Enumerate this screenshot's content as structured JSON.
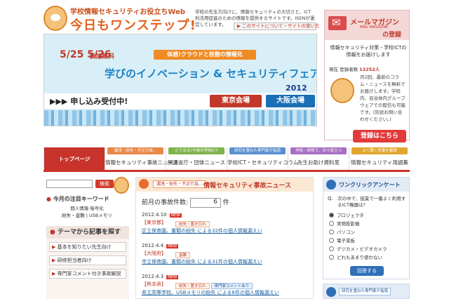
{
  "header": {
    "tagline": "学校情報セキュリティお役立ちWeb",
    "logo_main": "今日もワンステップ!",
    "description": "学校の先生方向けに、情報セキュリティの大切さと、ICT利活用促進のための情報を提供するサイトです。ISENが運営しています。",
    "about_link": "▶ このサイトについて・サイトの使い方"
  },
  "banner": {
    "dates": "5/25 5/26",
    "free": "参加無料",
    "ribbon": "体感!クラウドと校務の情報化",
    "fair_title": "学びのイノベーション & セキュリティフェア",
    "year": "2012",
    "apply": "▶▶▶ 申し込み受付中!",
    "venue_tokyo": "東京会場",
    "venue_osaka": "大阪会場"
  },
  "mail": {
    "title": "メールマガジン",
    "subtitle": "MAIL MAGAZINE",
    "title2": "の登録",
    "intro": "情報セキュリティ対策・学校ICTの情報をお届けします",
    "registered_label": "現在 登録者数",
    "registered_count": "13252人",
    "body": "月2回、最新のコラム・ニュースを無料でお届けします。学校内、自治体内グループウェアでの配信も可能です。(別途お問い合わせください。)",
    "register_button": "登録はこちら"
  },
  "nav": {
    "items": [
      {
        "pill": "",
        "label": "トップページ"
      },
      {
        "pill": "漏洩・紛失・不正行為…",
        "label": "情報セキュリティ事故ニュース"
      },
      {
        "pill": "どうなる?今後の学校ICT",
        "label": "関連省庁・団体ニュース"
      },
      {
        "pill": "研究を重ねた専門家が指南",
        "label": "学校ICT・セキュリティコラム"
      },
      {
        "pill": "学校・研修で、日々役立つ",
        "label": "先生お助け資料室"
      },
      {
        "pill": "よく聞く言葉を解説",
        "label": "情報セキュリティ用語集"
      }
    ]
  },
  "left": {
    "search_button": "検索",
    "keyword_title": "今月の注目キーワード",
    "keyword_links": "個人情報   暗号化 \n 紛失・盗難 | USBメモリ",
    "theme_title": "テーマから記事を探す",
    "theme_items": [
      "基本を知りたい先生向け",
      "研修担当者向け",
      "専門家コメント付き事故解説"
    ]
  },
  "center": {
    "pill": "漏洩・紛失・不正行為…",
    "title": "情報セキュリティ事故ニュース",
    "count_label": "前月の事故件数:",
    "count_value": "6",
    "count_unit": "件",
    "news": [
      {
        "date": "2012.4.10",
        "new": "NEW",
        "pref": "【東京都】",
        "tags": [
          "紛失・置き忘れ"
        ],
        "title": "区立保育園、書類の紛失 による32件の個人情報漏えい"
      },
      {
        "date": "2012.4.4",
        "new": "NEW",
        "pref": "【大阪府】",
        "tags": [
          "盗難"
        ],
        "title": "市立保育園、書類の紛失 による31件の個人情報漏えい"
      },
      {
        "date": "2012.4.3",
        "new": "NEW",
        "pref": "【熊本県】",
        "tags": [
          "紛失・置き忘れ",
          "専門家コメントあり"
        ],
        "title": "県立高等学校、USBメモリの紛失 による6件の個人情報漏えい"
      }
    ]
  },
  "right": {
    "poll_title": "ワンクリックアンケート",
    "poll_qn": "Q.",
    "poll_question": "次の中で、授業で一番よく利用するICT機器は?",
    "options": [
      "プロジェクタ",
      "実物投影機",
      "パソコン",
      "電子黒板",
      "デジカメ・ビデオカメラ",
      "どれもあまり使わない"
    ],
    "selected": 0,
    "vote_button": "回答する",
    "expert_pill": "研究を重ねた専門家が指南"
  }
}
